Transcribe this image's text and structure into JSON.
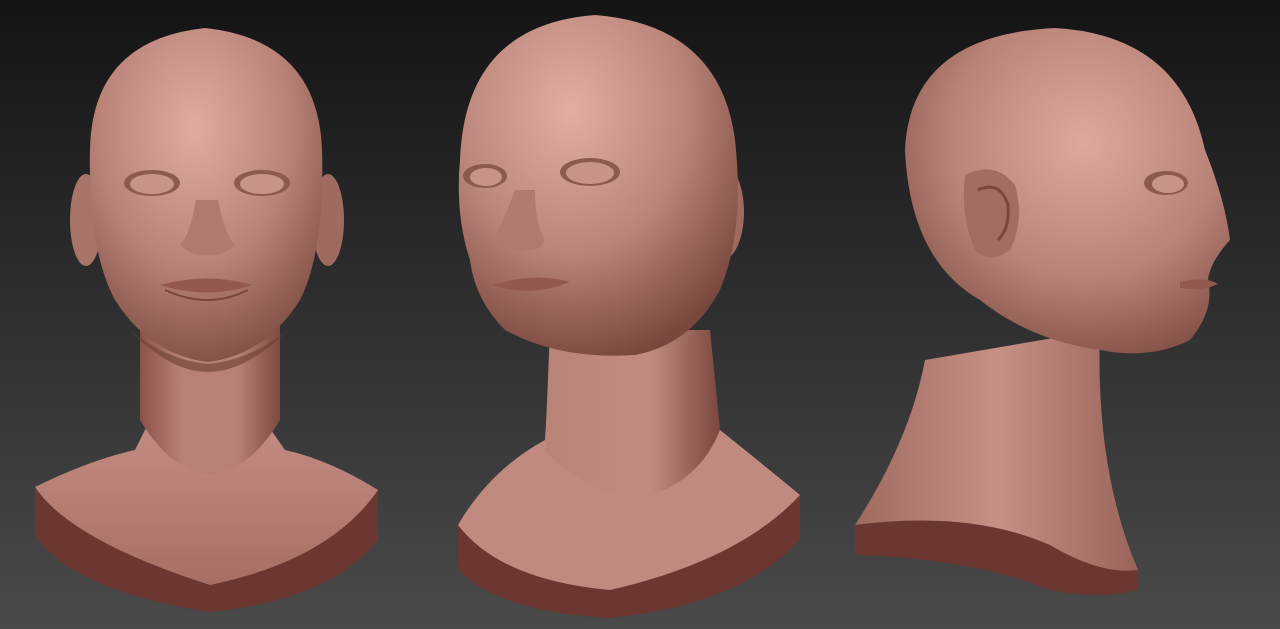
{
  "scene": {
    "type": "3D sculpt render (bust turntable)",
    "views": [
      {
        "id": "front",
        "label": ""
      },
      {
        "id": "three-quarter",
        "label": ""
      },
      {
        "id": "side",
        "label": ""
      }
    ]
  },
  "colors": {
    "background_top": "#141414",
    "background_bottom": "#4a4a4a",
    "skin_light": "#d9a59b",
    "skin_mid": "#b8847a",
    "skin_dark": "#7f4e45",
    "base_edge": "#6e3a33"
  }
}
